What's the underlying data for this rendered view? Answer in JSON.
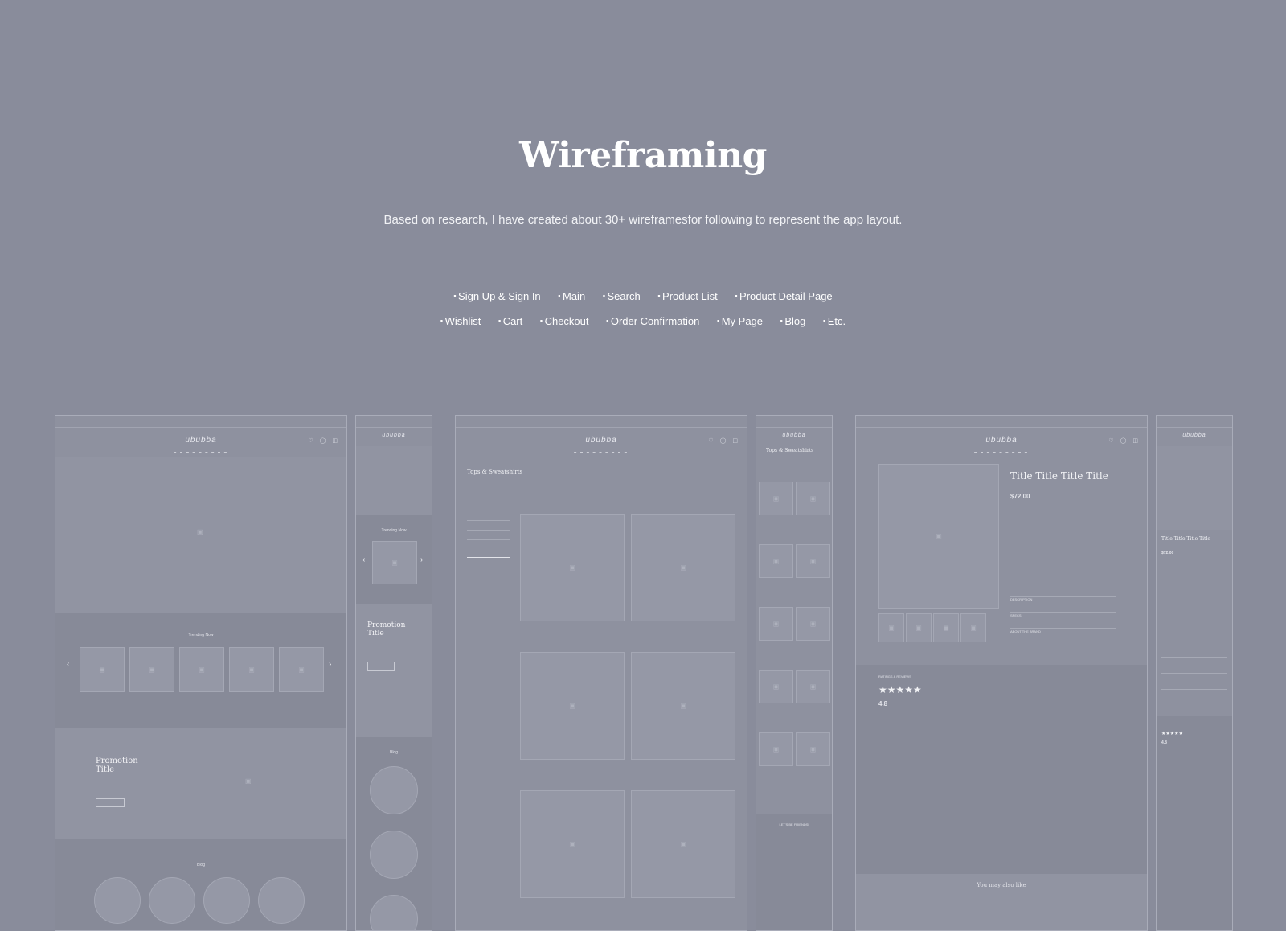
{
  "heading": {
    "title": "Wireframing",
    "description": "Based on research, I have created about 30+ wireframesfor following to represent the app layout."
  },
  "pages_row1": [
    "Sign Up & Sign In",
    "Main",
    "Search",
    "Product List",
    "Product Detail Page"
  ],
  "pages_row2": [
    "Wishlist",
    "Cart",
    "Checkout",
    "Order Confirmation",
    "My Page",
    "Blog",
    "Etc."
  ],
  "wireframe": {
    "logo": "ububba",
    "trending": "Trending Now",
    "promotion": "Promotion Title",
    "blog": "Blog",
    "list_title": "Tops & Sweatshirts",
    "product_title": "Title Title Title Title",
    "price": "$72.00",
    "rating": "4.8",
    "ratings_label": "RATINGS & REVIEWS",
    "section_description": "DESCRIPTION",
    "section_specs": "SPECS",
    "section_brand": "ABOUT THE BRAND",
    "you_may_like": "You may also like",
    "friends": "LET'S BE FRIENDS!",
    "item_title": "Title Title Title"
  }
}
